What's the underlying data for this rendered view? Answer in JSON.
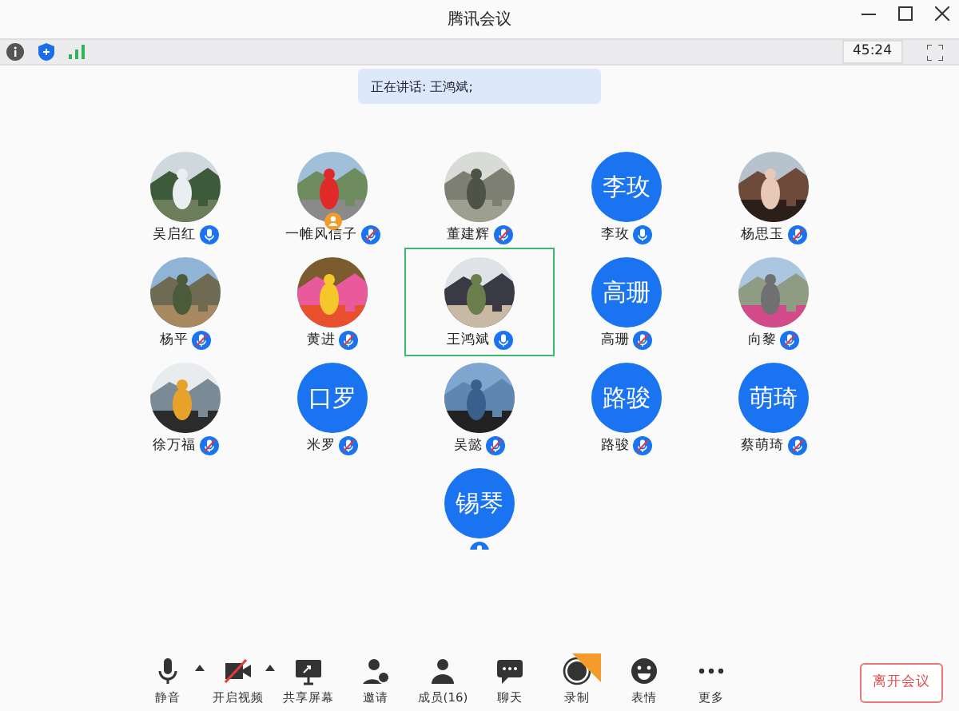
{
  "window": {
    "title": "腾讯会议"
  },
  "info_bar": {
    "timer": "45:24"
  },
  "speaking_banner": "正在讲话: 王鸿斌;",
  "participants": [
    {
      "name": "吴启红",
      "muted": false,
      "host": false,
      "speaking": false
    },
    {
      "name": "一帷风信子",
      "muted": true,
      "host": true,
      "speaking": false
    },
    {
      "name": "董建辉",
      "muted": true,
      "host": false,
      "speaking": false
    },
    {
      "name": "李玫",
      "avatar": {
        "kind": "initials",
        "text": "李玫"
      },
      "muted": false,
      "host": false,
      "speaking": false
    },
    {
      "name": "杨思玉",
      "muted": true,
      "host": false,
      "speaking": false
    },
    {
      "name": "杨平",
      "muted": true,
      "host": false,
      "speaking": false
    },
    {
      "name": "黄进",
      "muted": true,
      "host": false,
      "speaking": false
    },
    {
      "name": "王鸿斌",
      "muted": false,
      "host": false,
      "speaking": true
    },
    {
      "name": "高珊",
      "avatar": {
        "kind": "initials",
        "text": "高珊"
      },
      "muted": true,
      "host": false,
      "speaking": false
    },
    {
      "name": "向黎",
      "muted": true,
      "host": false,
      "speaking": false
    },
    {
      "name": "徐万福",
      "muted": true,
      "host": false,
      "speaking": false
    },
    {
      "name": "米罗",
      "avatar": {
        "kind": "initials",
        "text": "口罗"
      },
      "muted": true,
      "host": false,
      "speaking": false
    },
    {
      "name": "吴懿",
      "muted": true,
      "host": false,
      "speaking": false
    },
    {
      "name": "路骏",
      "avatar": {
        "kind": "initials",
        "text": "路骏"
      },
      "muted": true,
      "host": false,
      "speaking": false
    },
    {
      "name": "蔡萌琦",
      "avatar": {
        "kind": "initials",
        "text": "萌琦"
      },
      "muted": true,
      "host": false,
      "speaking": false
    },
    {
      "avatar": {
        "kind": "initials",
        "text": "锡琴"
      },
      "muted": false,
      "host": false,
      "speaking": false
    }
  ],
  "toolbar": [
    {
      "label": "静音",
      "kind": "mic",
      "menu": true
    },
    {
      "label": "开启视频",
      "kind": "video-off",
      "menu": true
    },
    {
      "label": "共享屏幕",
      "kind": "share",
      "menu": false
    },
    {
      "label": "邀请",
      "kind": "invite",
      "menu": false
    },
    {
      "label": "成员(16)",
      "kind": "members",
      "menu": false
    },
    {
      "label": "聊天",
      "kind": "chat",
      "menu": false
    },
    {
      "label": "录制",
      "kind": "record",
      "menu": false,
      "badge": true
    },
    {
      "label": "表情",
      "kind": "emoji",
      "menu": false
    },
    {
      "label": "更多",
      "kind": "more",
      "menu": false
    }
  ],
  "leave_button": "离开会议"
}
